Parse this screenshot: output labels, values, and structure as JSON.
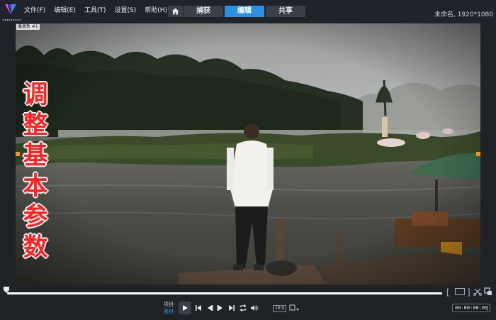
{
  "menu": {
    "items": [
      "文件(F)",
      "编辑(E)",
      "工具(T)",
      "设置(S)",
      "帮助(H)"
    ]
  },
  "tabs": {
    "home_icon": "home-icon",
    "items": [
      {
        "label": "捕获",
        "active": false
      },
      {
        "label": "编辑",
        "active": true
      },
      {
        "label": "共享",
        "active": false
      }
    ]
  },
  "project": {
    "info": "未命名, 1920*1080"
  },
  "preview": {
    "overlay_label": "覆叠轨 #1",
    "caption": [
      "调",
      "整",
      "基",
      "本",
      "参",
      "数"
    ]
  },
  "player": {
    "mode_project": "项目-",
    "mode_clip": "素材-",
    "aspect_ratio": "16:9",
    "timecode": "00:00:00:00"
  },
  "colors": {
    "accent": "#2e8fe0",
    "caption_text": "#ff2222",
    "handle": "#f29a18"
  }
}
